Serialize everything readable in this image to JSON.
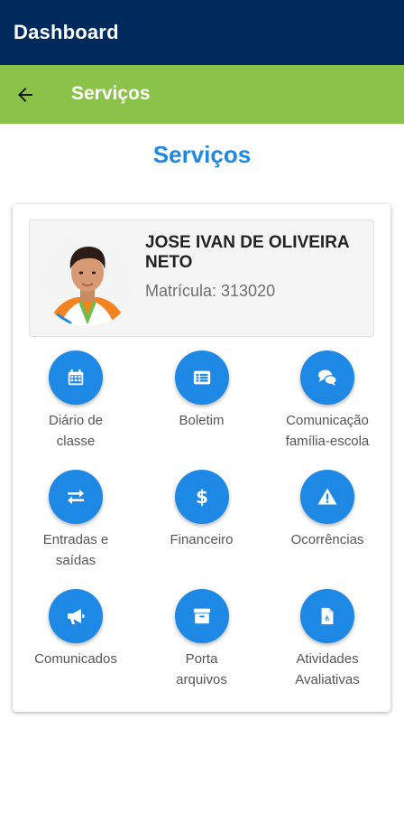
{
  "app_bar": {
    "title": "Dashboard"
  },
  "sub_bar": {
    "back_icon": "arrow-left-icon",
    "title": "Serviços"
  },
  "page": {
    "heading": "Serviços"
  },
  "student": {
    "name": "JOSE IVAN DE OLIVEIRA NETO",
    "registration": "Matrícula: 313020"
  },
  "colors": {
    "app_bar": "#002a5c",
    "sub_bar": "#8bc34a",
    "accent": "#1e88e5"
  },
  "services": [
    {
      "label": "Diário de\nclasse",
      "icon": "calendar-icon"
    },
    {
      "label": "Boletim",
      "icon": "list-alt-icon"
    },
    {
      "label": "Comunicação\nfamília-escola",
      "icon": "chat-bubbles-icon"
    },
    {
      "label": "Entradas e\nsaídas",
      "icon": "exchange-arrows-icon"
    },
    {
      "label": "Financeiro",
      "icon": "dollar-icon"
    },
    {
      "label": "Ocorrências",
      "icon": "warning-triangle-icon"
    },
    {
      "label": "Comunicados",
      "icon": "megaphone-icon"
    },
    {
      "label": "Porta\narquivos",
      "icon": "archive-box-icon"
    },
    {
      "label": "Atividades\nAvaliativas",
      "icon": "file-document-icon"
    }
  ]
}
